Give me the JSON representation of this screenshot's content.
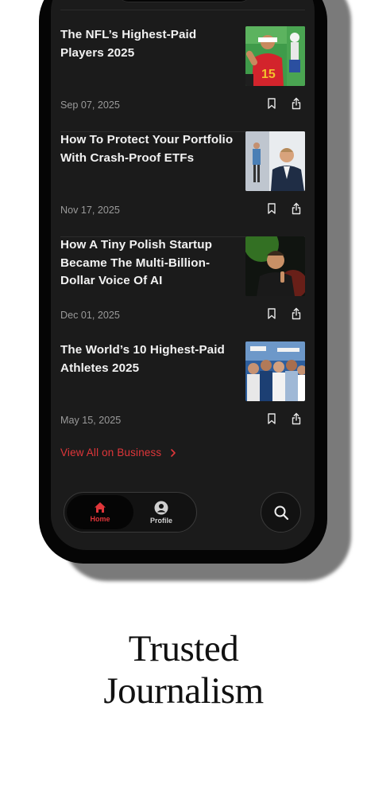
{
  "articles": [
    {
      "title": "The NFL’s Highest-Paid Players 2025",
      "date": "Sep 07, 2025",
      "image": "football-player-photo"
    },
    {
      "title": "How To Protect Your Portfolio With Crash-Proof ETFs",
      "date": "Nov 17, 2025",
      "image": "businessmen-photo"
    },
    {
      "title": "How A Tiny Polish Startup Became The Multi-Billion-Dollar Voice Of AI",
      "date": "Dec 01, 2025",
      "image": "speaker-green-light-photo"
    },
    {
      "title": "The World’s 10 Highest-Paid Athletes 2025",
      "date": "May 15, 2025",
      "image": "athletes-collage-photo"
    }
  ],
  "view_all": {
    "label": "View All on Business"
  },
  "tabbar": {
    "home_label": "Home",
    "profile_label": "Profile"
  },
  "tagline": {
    "line1": "Trusted",
    "line2": "Journalism"
  },
  "colors": {
    "accent": "#e0363a",
    "screen_bg": "#1b1b1b",
    "page_bg": "#ffffff"
  }
}
